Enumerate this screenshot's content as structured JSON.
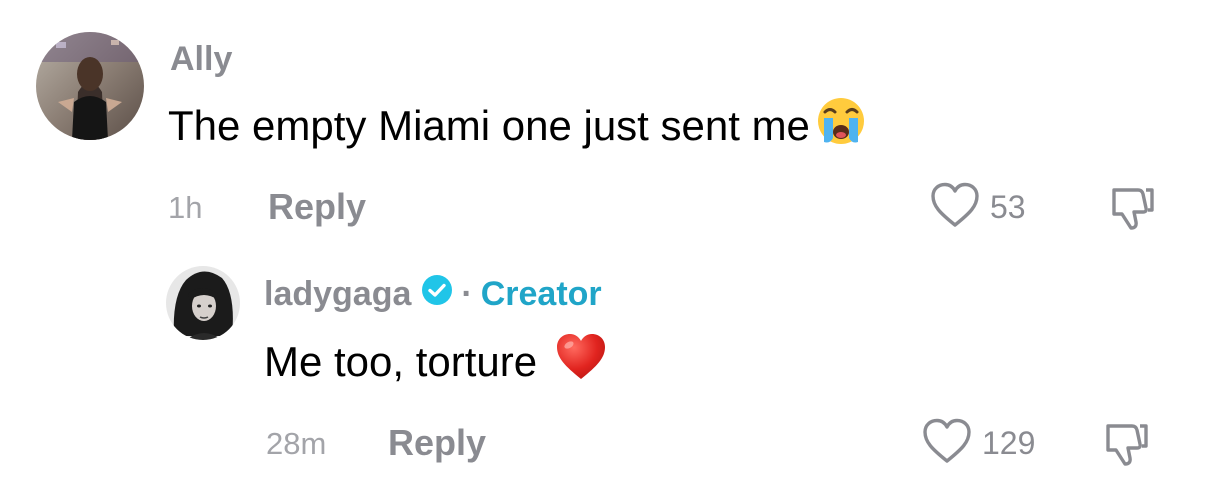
{
  "comments": [
    {
      "username": "Ally",
      "text": "The empty Miami one just sent me",
      "emoji": "loudly-crying-face",
      "time": "1h",
      "reply_label": "Reply",
      "likes": "53"
    }
  ],
  "reply": {
    "username": "ladygaga",
    "verified": true,
    "separator": "·",
    "badge": "Creator",
    "text": "Me too, torture",
    "emoji": "red-heart",
    "time": "28m",
    "reply_label": "Reply",
    "likes": "129"
  },
  "colors": {
    "username": "#8a8b91",
    "meta": "#a3a4a9",
    "creator_badge": "#20a5c8",
    "verified": "#20c5e8",
    "heart": "#e1241f"
  }
}
